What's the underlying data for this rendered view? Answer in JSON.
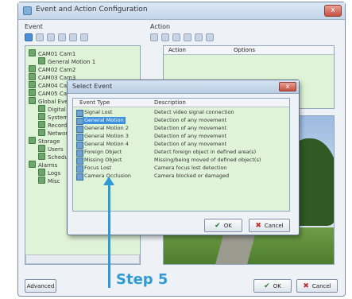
{
  "window": {
    "title": "Event and Action Configuration",
    "close_label": "x"
  },
  "event_group": {
    "label": "Event",
    "tree": [
      "CAM01 Cam1",
      "General Motion 1",
      "CAM02 Cam2",
      "CAM03 Cam3",
      "CAM04 Cam4",
      "CAM05 Cam5",
      "Global Events",
      "Digital Inputs",
      "System Events",
      "Recording",
      "Network",
      "Storage",
      "Users",
      "Scheduler",
      "Alarms",
      "Logs",
      "Misc"
    ]
  },
  "action_group": {
    "label": "Action",
    "columns": [
      "Action",
      "Options"
    ]
  },
  "select_event_dialog": {
    "title": "Select Event",
    "close_label": "x",
    "columns": [
      "Event Type",
      "Description"
    ],
    "rows": [
      {
        "type": "Signal Lost",
        "desc": "Detect video signal connection"
      },
      {
        "type": "General Motion",
        "desc": "Detection of any movement"
      },
      {
        "type": "General Motion 2",
        "desc": "Detection of any movement"
      },
      {
        "type": "General Motion 3",
        "desc": "Detection of any movement"
      },
      {
        "type": "General Motion 4",
        "desc": "Detection of any movement"
      },
      {
        "type": "Foreign Object",
        "desc": "Detect foreign object in defined area(s)"
      },
      {
        "type": "Missing Object",
        "desc": "Missing/being moved of defined object(s)"
      },
      {
        "type": "Focus Lost",
        "desc": "Camera focus lost detection"
      },
      {
        "type": "Camera Occlusion",
        "desc": "Camera blocked or damaged"
      }
    ],
    "selected_index": 1,
    "ok_label": "OK",
    "cancel_label": "Cancel"
  },
  "footer": {
    "advanced_label": "Advanced",
    "ok_label": "OK",
    "cancel_label": "Cancel"
  },
  "annotation": {
    "step_text": "Step 5",
    "color": "#2e9ad6"
  },
  "colors": {
    "panel_bg": "#dff3d8",
    "selection": "#3d8fe0",
    "window_bg": "#eef1f5"
  }
}
